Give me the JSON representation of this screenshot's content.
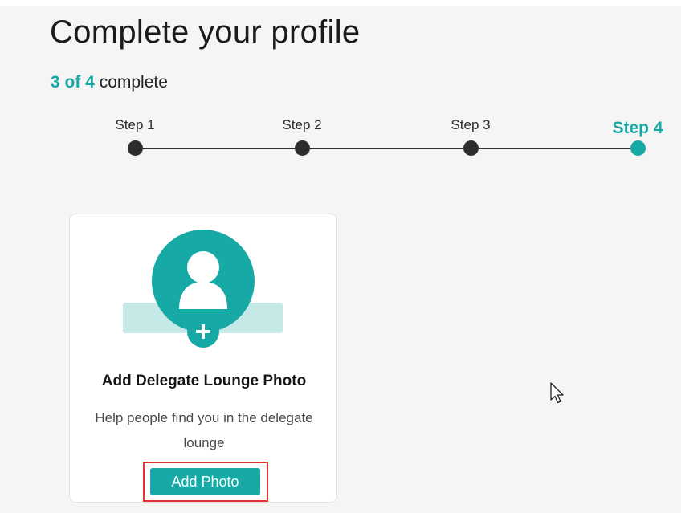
{
  "header": {
    "title": "Complete your profile",
    "progress_count": "3 of 4",
    "progress_suffix": " complete",
    "progress_fraction": 0.75
  },
  "stepper": {
    "steps": [
      {
        "label": "Step 1",
        "state": "completed"
      },
      {
        "label": "Step 2",
        "state": "completed"
      },
      {
        "label": "Step 3",
        "state": "completed"
      },
      {
        "label": "Step 4",
        "state": "active"
      }
    ],
    "active_color": "#17a9a6",
    "completed_color": "#2d2d2d"
  },
  "photo_card": {
    "illustration_icon": "user-avatar-plus-icon",
    "title": "Add Delegate Lounge Photo",
    "description": "Help people find you in the delegate lounge",
    "button_label": "Add Photo",
    "accent_color": "#17a9a6",
    "highlight_color": "#e0322e"
  },
  "cursor": {
    "icon": "mouse-pointer-icon"
  }
}
